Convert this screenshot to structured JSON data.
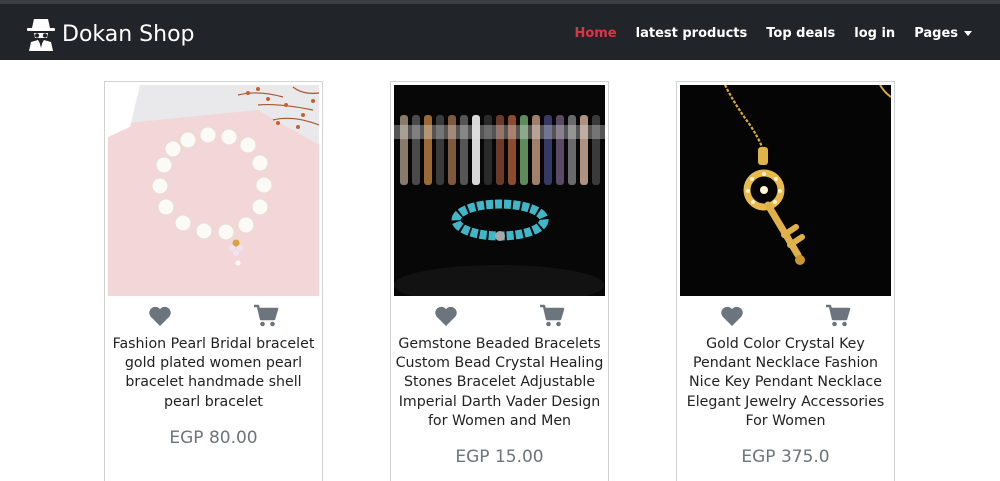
{
  "navbar": {
    "brand": "Dokan Shop",
    "brand_icon": "spy-hat-icon",
    "links": [
      {
        "label": "Home",
        "active": true
      },
      {
        "label": "latest products"
      },
      {
        "label": "Top deals"
      },
      {
        "label": "log in"
      },
      {
        "label": "Pages",
        "dropdown": true
      }
    ]
  },
  "colors": {
    "navbar_bg": "#212529",
    "active_link": "#dc3545",
    "icon_gray": "#6c757d"
  },
  "products": [
    {
      "title": "Fashion Pearl Bridal bracelet gold plated women pearl bracelet handmade shell pearl bracelet",
      "price": "EGP 80.00",
      "image": "pearl-bracelet-image"
    },
    {
      "title": "Gemstone Beaded Bracelets Custom Bead Crystal Healing Stones Bracelet Adjustable Imperial Darth Vader Design for Women and Men",
      "price": "EGP 15.00",
      "image": "beaded-bracelets-image"
    },
    {
      "title": "Gold Color Crystal Key Pendant Necklace Fashion Nice Key Pendant Necklace Elegant Jewelry Accessories For Women",
      "price": "EGP 375.0",
      "image": "key-pendant-necklace-image"
    }
  ],
  "icons": {
    "wishlist": "heart-icon",
    "cart": "cart-icon"
  }
}
